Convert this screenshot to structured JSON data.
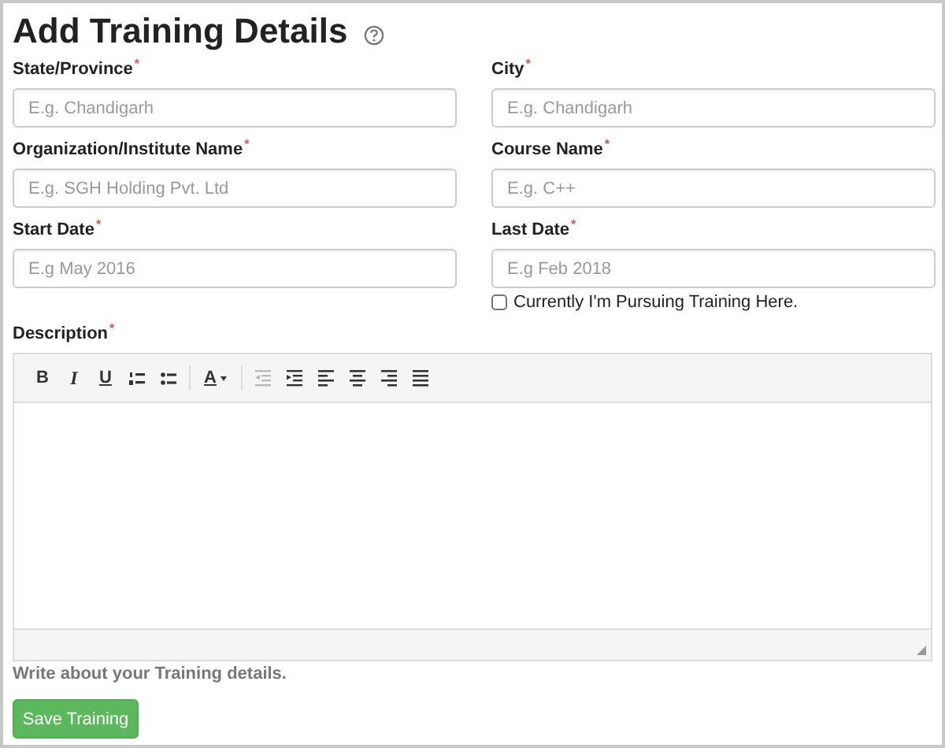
{
  "title": "Add Training Details",
  "fields": [
    {
      "label": "State/Province",
      "mark": "*",
      "placeholder": "E.g. Chandigarh"
    },
    {
      "label": "City",
      "mark": "*",
      "placeholder": "E.g. Chandigarh"
    },
    {
      "label": "Organization/Institute Name",
      "mark": "*",
      "placeholder": "E.g. SGH Holding Pvt. Ltd"
    },
    {
      "label": "Course Name",
      "mark": "*",
      "placeholder": "E.g. C++"
    },
    {
      "label": "Start Date",
      "mark": "*",
      "placeholder": "E.g May 2016"
    },
    {
      "label": "Last Date",
      "mark": "*",
      "placeholder": "E.g Feb 2018"
    }
  ],
  "pursuing": {
    "label": "Currently I'm Pursuing Training Here.",
    "checked": false
  },
  "description": {
    "label": "Description",
    "mark": "*",
    "help": "Write about your Training details.",
    "toolbar": [
      {
        "kind": "bold",
        "text": "B",
        "disabled": false
      },
      {
        "kind": "italic",
        "text": "I",
        "disabled": false
      },
      {
        "kind": "underline",
        "text": "U",
        "disabled": false
      },
      {
        "kind": "ordered-list",
        "disabled": false
      },
      {
        "kind": "bullet-list",
        "disabled": false
      },
      {
        "kind": "separator"
      },
      {
        "kind": "font-color",
        "text": "A",
        "disabled": false
      },
      {
        "kind": "separator"
      },
      {
        "kind": "outdent",
        "disabled": true
      },
      {
        "kind": "indent",
        "disabled": false
      },
      {
        "kind": "align-left",
        "disabled": false
      },
      {
        "kind": "align-center",
        "disabled": false
      },
      {
        "kind": "align-right",
        "disabled": false
      },
      {
        "kind": "justify",
        "disabled": false
      }
    ]
  },
  "save_button": "Save Training"
}
